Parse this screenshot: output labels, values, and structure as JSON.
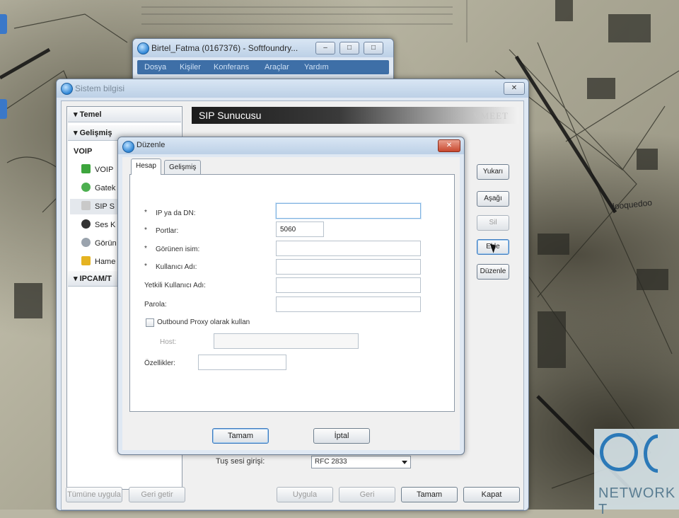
{
  "desktop": {
    "brand_text": "NETWORK T",
    "decor_text": "looquedoo"
  },
  "app_window": {
    "title": "Birtel_Fatma (0167376) - Softfoundry...",
    "menus": [
      "Dosya",
      "Kişiler",
      "Konferans",
      "Araçlar",
      "Yardım"
    ],
    "controls": [
      "‒",
      "□",
      "□"
    ]
  },
  "system_window": {
    "title": "Sistem bilgisi",
    "close_glyph": "✕",
    "nav": {
      "temel": "Temel",
      "gelismis": "Gelişmiş",
      "voip": "VOIP",
      "items": [
        "VOIP",
        "Gatek",
        "SIP S",
        "Ses K",
        "Görün",
        "Hame"
      ],
      "ipcam": "IPCAM/T"
    },
    "section_title": "SIP Sunucusu",
    "section_logo": "VMEET",
    "side_buttons": {
      "up": "Yukarı",
      "down": "Aşağı",
      "delete": "Sil",
      "add": "Ekle",
      "edit": "Düzenle"
    },
    "dtmf": {
      "label": "Tuş sesi girişi:",
      "value": "RFC 2833"
    },
    "bottom_buttons": {
      "apply_all": "Tümüne uygula",
      "restore": "Geri getir",
      "apply": "Uygula",
      "back": "Geri",
      "ok": "Tamam",
      "close": "Kapat"
    }
  },
  "edit_dialog": {
    "title": "Düzenle",
    "close_glyph": "✕",
    "tabs": [
      "Hesap",
      "Gelişmiş"
    ],
    "required_mark": "*",
    "fields": {
      "ip_dn": {
        "label": "IP  ya da DN:",
        "value": ""
      },
      "ports": {
        "label": "Portlar:",
        "value": "5060"
      },
      "display_name": {
        "label": "Görünen isim:",
        "value": ""
      },
      "username": {
        "label": "Kullanıcı Adı:",
        "value": ""
      },
      "auth_username": {
        "label": "Yetkili Kullanıcı Adı:",
        "value": ""
      },
      "password": {
        "label": "Parola:",
        "value": ""
      },
      "outbound_proxy": {
        "label": "Outbound Proxy olarak kullan"
      },
      "host": {
        "label": "Host:",
        "value": ""
      },
      "properties": {
        "label": "Özellikler:",
        "value": ""
      }
    },
    "buttons": {
      "ok": "Tamam",
      "cancel": "İptal"
    }
  }
}
